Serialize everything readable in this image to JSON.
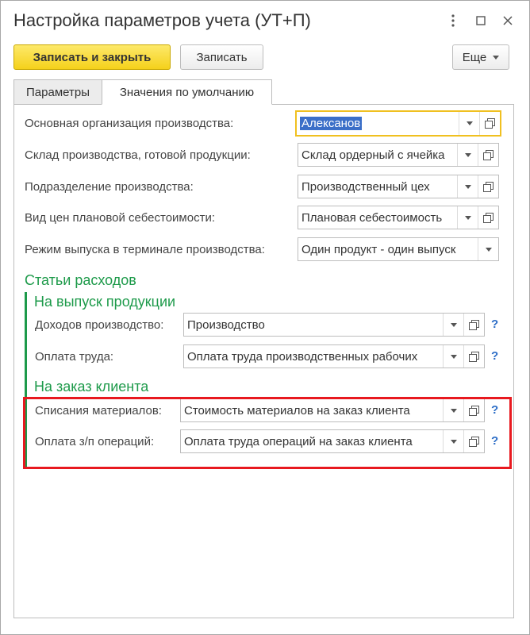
{
  "window": {
    "title": "Настройка параметров учета (УТ+П)"
  },
  "toolbar": {
    "save_close_label": "Записать и закрыть",
    "save_label": "Записать",
    "more_label": "Еще"
  },
  "tabs": [
    {
      "label": "Параметры"
    },
    {
      "label": "Значения по умолчанию"
    }
  ],
  "fields": [
    {
      "label": "Основная организация производства:",
      "value": "Алексанов"
    },
    {
      "label": "Склад производства, готовой продукции:",
      "value": "Склад ордерный с ячейка"
    },
    {
      "label": "Подразделение производства:",
      "value": "Производственный цех"
    },
    {
      "label": "Вид цен плановой себестоимости:",
      "value": "Плановая себестоимость"
    },
    {
      "label": "Режим выпуска в терминале производства:",
      "value": "Один продукт - один выпуск"
    }
  ],
  "expenses": {
    "title": "Статьи расходов",
    "release": {
      "title": "На выпуск продукции",
      "rows": [
        {
          "label": "Доходов производство:",
          "value": "Производство"
        },
        {
          "label": "Оплата труда:",
          "value": "Оплата труда производственных рабочих"
        }
      ]
    },
    "order": {
      "title": "На заказ клиента",
      "rows": [
        {
          "label": "Списания материалов:",
          "value": "Стоимость материалов на заказ клиента"
        },
        {
          "label": "Оплата з/п  операций:",
          "value": "Оплата труда операций на заказ клиента"
        }
      ]
    }
  },
  "help_glyph": "?",
  "colors": {
    "accent_green": "#1d9a4a",
    "primary_button": "#f5d11b",
    "highlight_red": "#e8191f",
    "help_blue": "#2d6ec7"
  }
}
